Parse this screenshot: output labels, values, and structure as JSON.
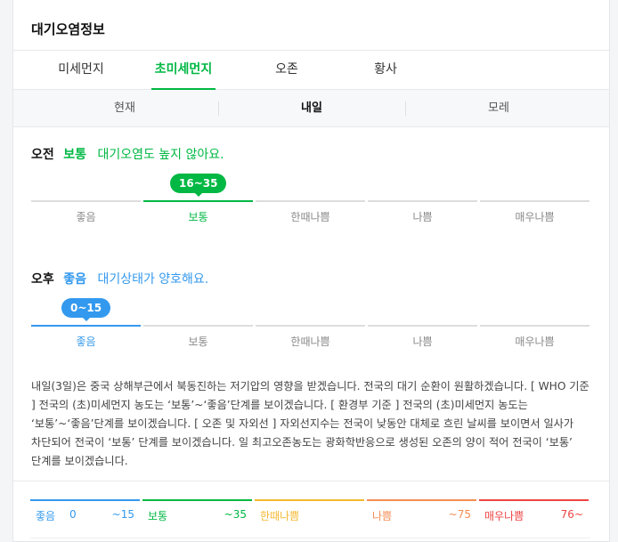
{
  "header": {
    "title": "대기오염정보"
  },
  "tabs": [
    {
      "label": "미세먼지"
    },
    {
      "label": "초미세먼지"
    },
    {
      "label": "오존"
    },
    {
      "label": "황사"
    }
  ],
  "active_tab": "초미세먼지",
  "subtabs": [
    {
      "label": "현재"
    },
    {
      "label": "내일"
    },
    {
      "label": "모레"
    }
  ],
  "active_subtab": "내일",
  "grades": [
    "좋음",
    "보통",
    "한때나쁨",
    "나쁨",
    "매우나쁨"
  ],
  "morning": {
    "when": "오전",
    "grade": "보통",
    "desc": "대기오염도 높지 않아요.",
    "range": "16~35",
    "grade_index": 1,
    "color": "#00b843"
  },
  "afternoon": {
    "when": "오후",
    "grade": "좋음",
    "desc": "대기상태가 양호해요.",
    "range": "0~15",
    "grade_index": 0,
    "color": "#3399ee"
  },
  "forecast_text": "내일(3일)은 중국 상해부근에서 북동진하는 저기압의 영향을 받겠습니다. 전국의 대기 순환이 원활하겠습니다. [ WHO 기준 ] 전국의 (초)미세먼지 농도는 ‘보통’~‘좋음’단계를 보이겠습니다. [ 환경부 기준 ] 전국의 (초)미세먼지 농도는 ‘보통’~‘좋음’단계를 보이겠습니다. [ 오존 및 자외선 ] 자외선지수는 전국이 낮동안 대체로 흐린 날씨를 보이면서 일사가 차단되어 전국이 ‘보통’ 단계를 보이겠습니다. 일 최고오존농도는 광화학반응으로 생성된 오존의 양이 적어 전국이 ‘보통’ 단계를 보이겠습니다.",
  "legend": [
    {
      "name": "좋음",
      "start": "0",
      "end": "~15",
      "color": "#3399ee"
    },
    {
      "name": "보통",
      "start": "",
      "end": "~35",
      "color": "#00b843"
    },
    {
      "name": "한때나쁨",
      "start": "",
      "end": "",
      "color": "#f5b82e"
    },
    {
      "name": "나쁨",
      "start": "",
      "end": "~75",
      "color": "#f58c54"
    },
    {
      "name": "매우나쁨",
      "start": "",
      "end": "76~",
      "color": "#ee4444"
    }
  ]
}
